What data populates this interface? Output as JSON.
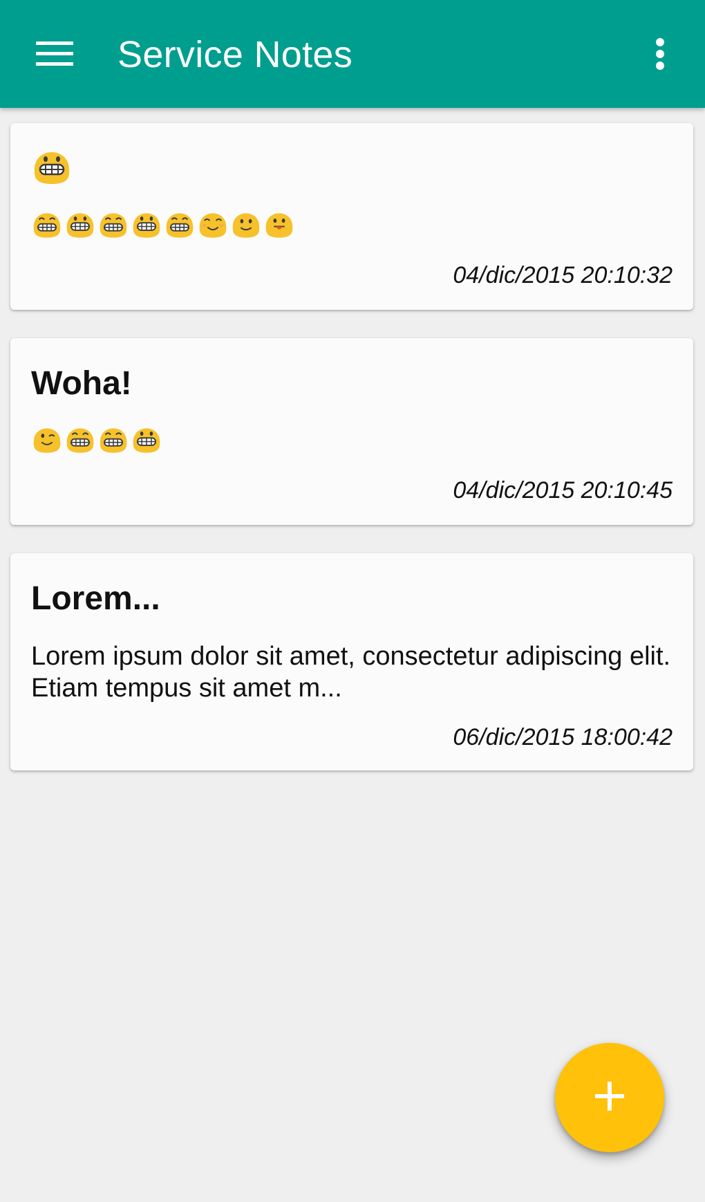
{
  "app_bar": {
    "title": "Service Notes",
    "background_color": "#009e8e",
    "menu_icon": "hamburger-menu-icon",
    "more_icon": "more-vert-icon"
  },
  "notes": [
    {
      "title_emoji": [
        "grinning"
      ],
      "body_emoji": [
        "grinning-eyes",
        "grinning",
        "grinning-eyes",
        "grinning",
        "grinning-eyes",
        "smiling-eyes",
        "slight-smile",
        "tongue-out"
      ],
      "date": "04/dic/2015 20:10:32"
    },
    {
      "title": "Woha!",
      "body_emoji": [
        "wink",
        "grinning-eyes",
        "grinning-eyes",
        "grinning"
      ],
      "date": "04/dic/2015 20:10:45"
    },
    {
      "title": "Lorem...",
      "body": "Lorem ipsum dolor sit amet, consectetur adipiscing elit. Etiam tempus sit amet m...",
      "date": "06/dic/2015 18:00:42"
    }
  ],
  "fab": {
    "icon": "plus-icon",
    "color": "#ffc10a"
  },
  "colors": {
    "emoji_face": "#f6c12a",
    "background": "#efefef",
    "card": "#fbfbfb"
  }
}
